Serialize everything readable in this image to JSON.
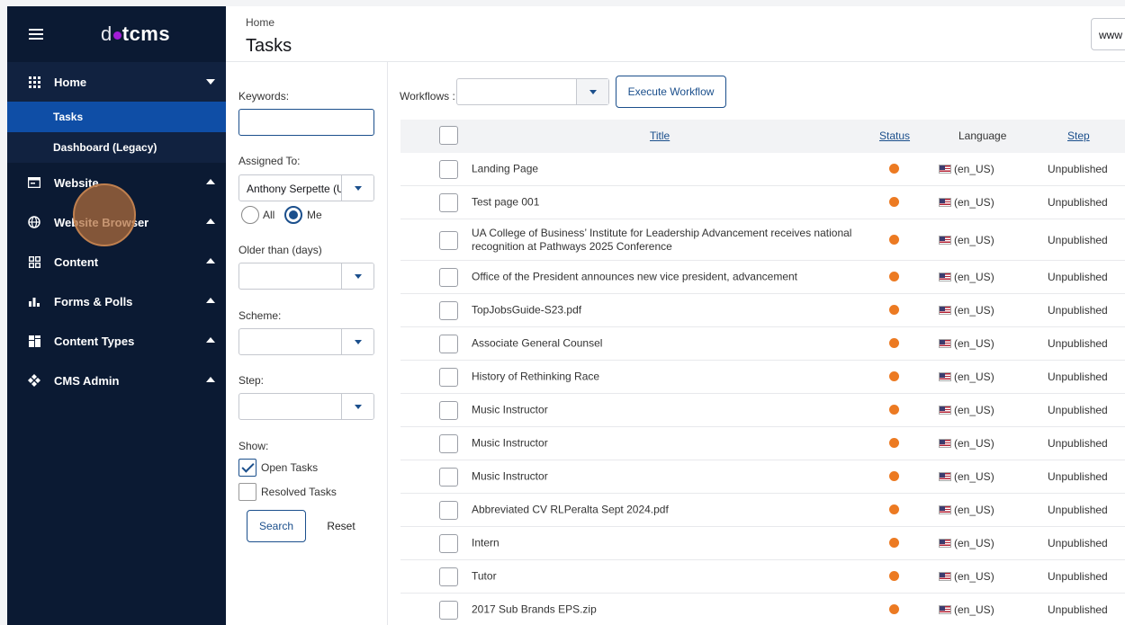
{
  "app": {
    "logo_prefix": "d",
    "logo_suffix": "tcms"
  },
  "colors": {
    "sidebar_bg": "#0b1a33",
    "active_item_bg": "#0f4ea6",
    "accent": "#1b4f8c",
    "status_dot": "#ec7a22"
  },
  "sidebar": {
    "home_label": "Home",
    "home_sub": [
      "Tasks",
      "Dashboard (Legacy)"
    ],
    "items": [
      {
        "label": "Website",
        "icon": "website-icon"
      },
      {
        "label": "Website Browser",
        "icon": "globe-icon"
      },
      {
        "label": "Content",
        "icon": "grid-icon"
      },
      {
        "label": "Forms & Polls",
        "icon": "bar-chart-icon"
      },
      {
        "label": "Content Types",
        "icon": "layout-icon"
      },
      {
        "label": "CMS Admin",
        "icon": "admin-icon"
      }
    ]
  },
  "header": {
    "breadcrumb": "Home",
    "title": "Tasks",
    "site_selector": "www"
  },
  "filters": {
    "keywords_label": "Keywords:",
    "keywords_value": "",
    "assigned_label": "Assigned To:",
    "assigned_value": "Anthony Serpette (U",
    "radio_all": "All",
    "radio_me": "Me",
    "older_label": "Older than (days)",
    "scheme_label": "Scheme:",
    "step_label": "Step:",
    "show_label": "Show:",
    "open_tasks": "Open Tasks",
    "resolved_tasks": "Resolved Tasks",
    "search_button": "Search",
    "reset_button": "Reset"
  },
  "toolbar": {
    "workflows_label": "Workflows :",
    "execute_button": "Execute Workflow"
  },
  "table": {
    "headers": {
      "title": "Title",
      "status": "Status",
      "language": "Language",
      "step": "Step"
    },
    "rows": [
      {
        "title": "Landing Page",
        "language": "(en_US)",
        "step": "Unpublished"
      },
      {
        "title": "Test page 001",
        "language": "(en_US)",
        "step": "Unpublished"
      },
      {
        "title": "UA College of Business’ Institute for Leadership Advancement receives national recognition at Pathways 2025 Conference",
        "language": "(en_US)",
        "step": "Unpublished"
      },
      {
        "title": "Office of the President announces new vice president, advancement",
        "language": "(en_US)",
        "step": "Unpublished"
      },
      {
        "title": "TopJobsGuide-S23.pdf",
        "language": "(en_US)",
        "step": "Unpublished"
      },
      {
        "title": "Associate General Counsel",
        "language": "(en_US)",
        "step": "Unpublished"
      },
      {
        "title": "History of Rethinking Race",
        "language": "(en_US)",
        "step": "Unpublished"
      },
      {
        "title": "Music Instructor",
        "language": "(en_US)",
        "step": "Unpublished"
      },
      {
        "title": "Music Instructor",
        "language": "(en_US)",
        "step": "Unpublished"
      },
      {
        "title": "Music Instructor",
        "language": "(en_US)",
        "step": "Unpublished"
      },
      {
        "title": "Abbreviated CV RLPeralta Sept 2024.pdf",
        "language": "(en_US)",
        "step": "Unpublished"
      },
      {
        "title": "Intern",
        "language": "(en_US)",
        "step": "Unpublished"
      },
      {
        "title": "Tutor",
        "language": "(en_US)",
        "step": "Unpublished"
      },
      {
        "title": "2017 Sub Brands EPS.zip",
        "language": "(en_US)",
        "step": "Unpublished"
      }
    ]
  }
}
